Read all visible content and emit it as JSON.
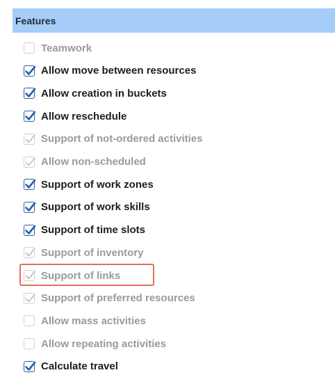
{
  "panel": {
    "title": "Features"
  },
  "items": [
    {
      "label": "Teamwork",
      "checked": false,
      "disabled": true
    },
    {
      "label": "Allow move between resources",
      "checked": true,
      "disabled": false
    },
    {
      "label": "Allow creation in buckets",
      "checked": true,
      "disabled": false
    },
    {
      "label": "Allow reschedule",
      "checked": true,
      "disabled": false
    },
    {
      "label": "Support of not-ordered activities",
      "checked": true,
      "disabled": true
    },
    {
      "label": "Allow non-scheduled",
      "checked": true,
      "disabled": true
    },
    {
      "label": "Support of work zones",
      "checked": true,
      "disabled": false
    },
    {
      "label": "Support of work skills",
      "checked": true,
      "disabled": false
    },
    {
      "label": "Support of time slots",
      "checked": true,
      "disabled": false
    },
    {
      "label": "Support of inventory",
      "checked": true,
      "disabled": true
    },
    {
      "label": "Support of links",
      "checked": true,
      "disabled": true,
      "highlighted": true
    },
    {
      "label": "Support of preferred resources",
      "checked": true,
      "disabled": true
    },
    {
      "label": "Allow mass activities",
      "checked": false,
      "disabled": true
    },
    {
      "label": "Allow repeating activities",
      "checked": false,
      "disabled": true
    },
    {
      "label": "Calculate travel",
      "checked": true,
      "disabled": false
    }
  ],
  "colors": {
    "header_bg": "#a6cdf9",
    "check_active": "#2b5da8",
    "check_disabled": "#bdbdbd",
    "highlight_border": "#e06f5a",
    "text_enabled": "#1d1d1d",
    "text_disabled": "#9a9a9a"
  },
  "icons": {
    "checkbox_checked": "checkmark-icon",
    "checkbox_unchecked": "empty-box-icon"
  }
}
